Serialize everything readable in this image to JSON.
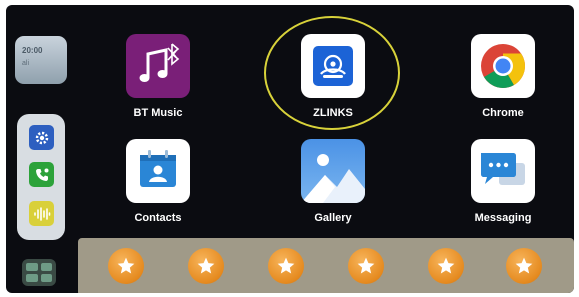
{
  "sidebar": {
    "weather_line1": "20:00",
    "weather_line2": "ali",
    "settings_icon": "gear-icon",
    "phone_icon": "phone-icon",
    "voice_icon": "waveform-icon",
    "grid_icon": "app-grid-icon"
  },
  "apps": [
    {
      "label": "BT Music",
      "icon": "music-note-bluetooth-icon",
      "color": "#7a1f78"
    },
    {
      "label": "ZLINKS",
      "icon": "zlink-logo-icon",
      "color": "#1c63d6",
      "highlighted": true
    },
    {
      "label": "Chrome",
      "icon": "chrome-icon",
      "color": "#ffffff"
    },
    {
      "label": "Contacts",
      "icon": "contacts-icon",
      "color": "#ffffff"
    },
    {
      "label": "Gallery",
      "icon": "gallery-icon",
      "color": "#5ba0ea"
    },
    {
      "label": "Messaging",
      "icon": "messaging-icon",
      "color": "#ffffff"
    }
  ],
  "highlight_color": "#d8d23a",
  "favorites": [
    {
      "icon": "star-icon"
    },
    {
      "icon": "star-icon"
    },
    {
      "icon": "star-icon"
    },
    {
      "icon": "star-icon"
    },
    {
      "icon": "star-icon"
    },
    {
      "icon": "star-icon"
    }
  ]
}
